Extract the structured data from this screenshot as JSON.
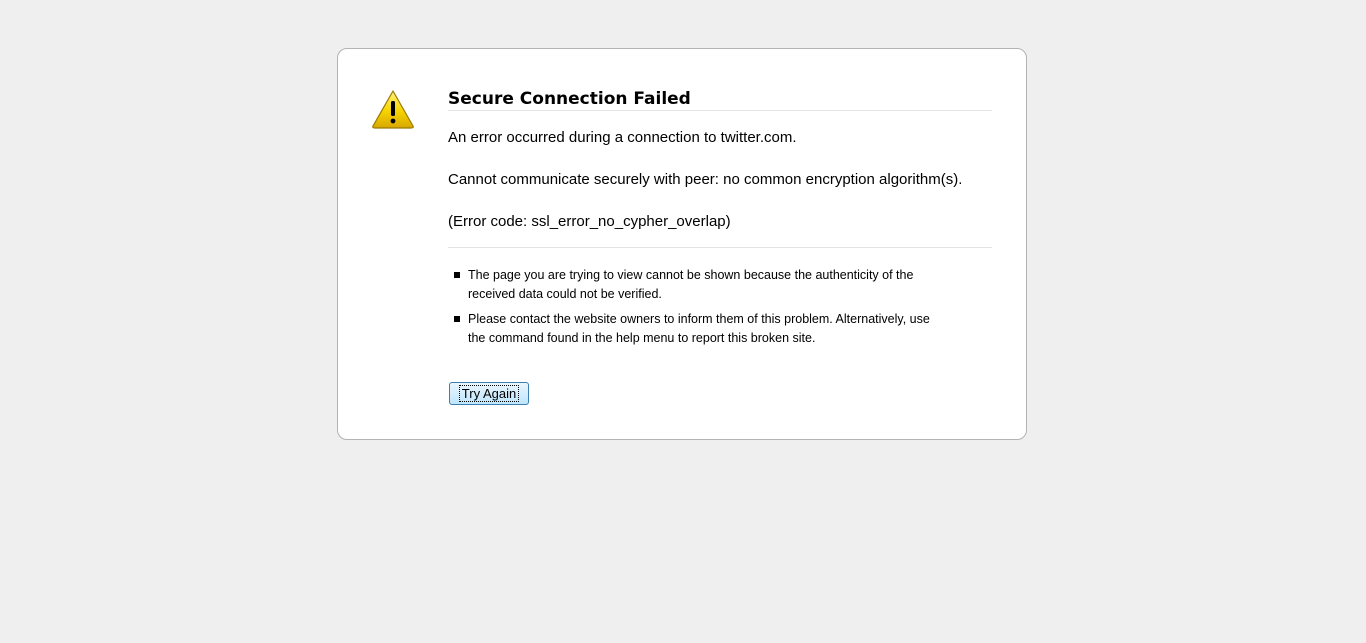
{
  "error": {
    "title": "Secure Connection Failed",
    "short_desc": [
      "An error occurred during a connection to twitter.com.",
      "Cannot communicate securely with peer: no common encryption algorithm(s).",
      "(Error code: ssl_error_no_cypher_overlap)"
    ],
    "long_desc": [
      "The page you are trying to view cannot be shown because the authenticity of the received data could not be verified.",
      "Please contact the website owners to inform them of this problem. Alternatively, use the command found in the help menu to report this broken site."
    ],
    "try_again_label": "Try Again",
    "icon": "warning-icon",
    "colors": {
      "background": "#efefef",
      "box": "#ffffff",
      "icon_yellow": "#f5d300",
      "button_border": "#3c7fb1"
    }
  }
}
